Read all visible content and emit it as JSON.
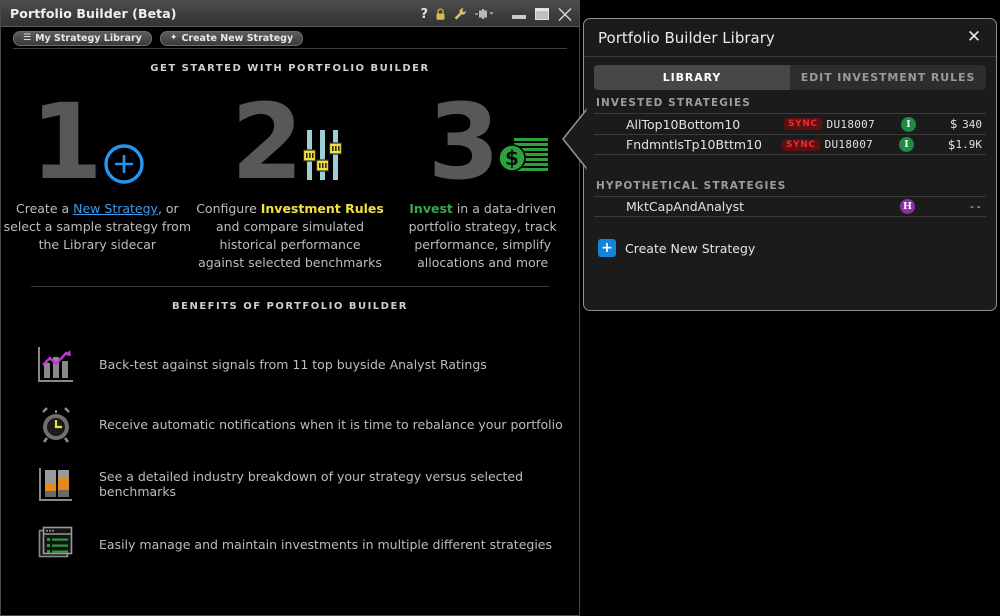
{
  "main_window": {
    "title": "Portfolio Builder (Beta)",
    "titlebar_icons": [
      {
        "name": "help-icon",
        "glyph": "?"
      },
      {
        "name": "lock-icon",
        "glyph": "lock"
      },
      {
        "name": "wrench-icon",
        "glyph": "wrench"
      },
      {
        "name": "pin-icon",
        "glyph": "pin"
      },
      {
        "name": "minimize-icon",
        "glyph": "minimize"
      },
      {
        "name": "maximize-icon",
        "glyph": "maximize"
      },
      {
        "name": "close-icon",
        "glyph": "close"
      }
    ],
    "tabs": [
      {
        "label": "My Strategy Library",
        "glyph": "☰"
      },
      {
        "label": "Create New Strategy",
        "glyph": "✦"
      }
    ]
  },
  "get_started": {
    "heading": "GET STARTED WITH PORTFOLIO BUILDER",
    "steps": [
      {
        "number": "1",
        "icon": "plus-circle-icon",
        "text_parts": [
          {
            "text": "Create a ",
            "style": "plain"
          },
          {
            "text": "New Strategy",
            "style": "link"
          },
          {
            "text": ", or select a sample strategy from the Library sidecar",
            "style": "plain"
          }
        ]
      },
      {
        "number": "2",
        "icon": "sliders-icon",
        "text_parts": [
          {
            "text": "Configure ",
            "style": "plain"
          },
          {
            "text": "Investment Rules",
            "style": "yellow"
          },
          {
            "text": " and compare simulated historical performance against selected benchmarks",
            "style": "plain"
          }
        ]
      },
      {
        "number": "3",
        "icon": "money-icon",
        "text_parts": [
          {
            "text": "Invest",
            "style": "green"
          },
          {
            "text": " in a data-driven portfolio strategy, track performance, simplify allocations and more",
            "style": "plain"
          }
        ]
      }
    ]
  },
  "benefits": {
    "heading": "BENEFITS OF PORTFOLIO BUILDER",
    "items": [
      {
        "icon": "bar-chart-trend-icon",
        "text": "Back-test against signals from 11 top buyside Analyst Ratings"
      },
      {
        "icon": "alarm-clock-icon",
        "text": "Receive automatic notifications when it is time to rebalance your portfolio"
      },
      {
        "icon": "industry-breakdown-icon",
        "text": "See a detailed industry breakdown of your strategy versus selected benchmarks"
      },
      {
        "icon": "list-window-icon",
        "text": "Easily manage and maintain investments in multiple different strategies"
      }
    ]
  },
  "library_panel": {
    "title": "Portfolio Builder Library",
    "close_label": "✕",
    "tabs": [
      {
        "label": "LIBRARY",
        "active": true
      },
      {
        "label": "EDIT INVESTMENT RULES",
        "active": false
      }
    ],
    "invested_heading": "INVESTED STRATEGIES",
    "invested": [
      {
        "name": "AllTop10Bottom10",
        "sync": "SYNC",
        "account": "DU18007",
        "badge": "I",
        "currency": "$",
        "amount": "340"
      },
      {
        "name": "FndmntlsTp10Bttm10",
        "sync": "SYNC",
        "account": "DU18007",
        "badge": "I",
        "currency": "$",
        "amount": "1.9K"
      }
    ],
    "hypothetical_heading": "HYPOTHETICAL STRATEGIES",
    "hypothetical": [
      {
        "name": "MktCapAndAnalyst",
        "badge": "H",
        "amount": "--"
      }
    ],
    "create_button": {
      "label": "Create New Strategy",
      "glyph": "+"
    }
  },
  "colors": {
    "accent_blue": "#1384d8",
    "link_blue": "#3b9cf0",
    "yellow": "#f0e040",
    "green": "#34a853",
    "sync_red": "#ef2b2b",
    "invested_green": "#1e8a42",
    "hypothetical_purple": "#8e2fa8"
  }
}
